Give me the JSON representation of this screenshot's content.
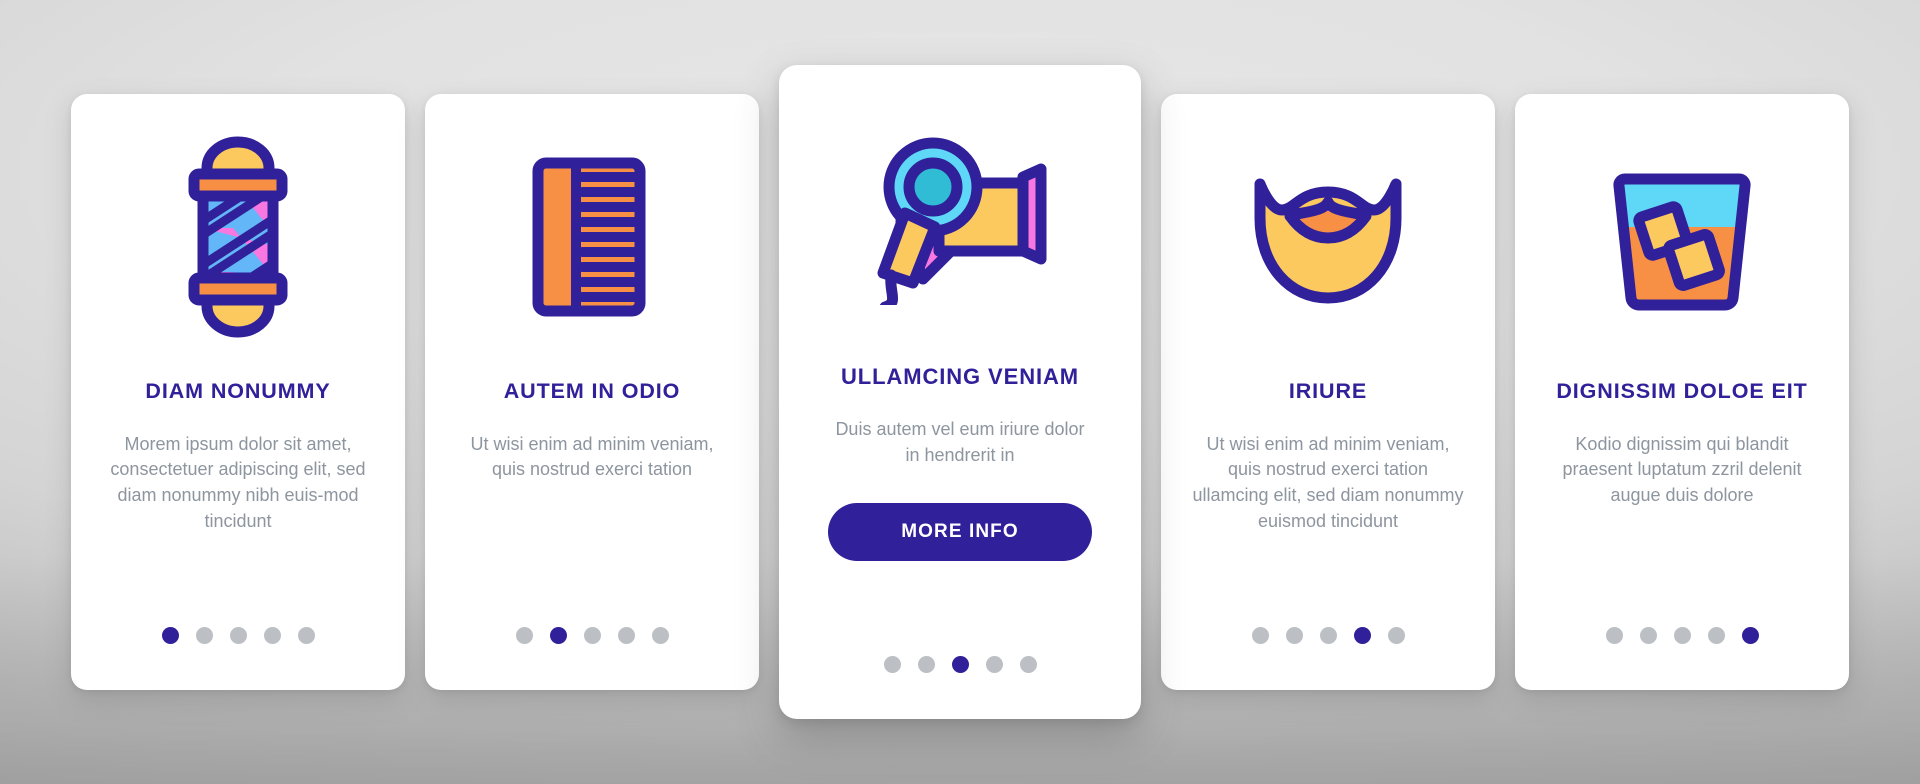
{
  "theme": {
    "purple": "#30209a",
    "body_text": "#8d959f",
    "dot_inactive": "#bcbfc4",
    "card_bg": "#ffffff",
    "background": "#d8d8d8"
  },
  "cards": [
    {
      "icon_name": "barber-pole-icon",
      "title": "DIAM NONUMMY",
      "body": "Morem ipsum dolor sit amet, consectetuer adipiscing elit, sed diam nonummy nibh euis-mod tincidunt",
      "featured": false,
      "dots_count": 5,
      "active_dot": 1
    },
    {
      "icon_name": "hair-comb-icon",
      "title": "AUTEM IN ODIO",
      "body": "Ut wisi enim ad minim veniam, quis nostrud exerci tation",
      "featured": false,
      "dots_count": 5,
      "active_dot": 2
    },
    {
      "icon_name": "hair-dryer-icon",
      "title": "ULLAMCING VENIAM",
      "body": "Duis autem vel eum iriure dolor in hendrerit in",
      "featured": true,
      "button_label": "MORE INFO",
      "dots_count": 5,
      "active_dot": 3
    },
    {
      "icon_name": "beard-icon",
      "title": "IRIURE",
      "body": "Ut wisi enim ad minim veniam, quis nostrud exerci tation ullamcing elit, sed diam nonummy euismod tincidunt",
      "featured": false,
      "dots_count": 5,
      "active_dot": 4
    },
    {
      "icon_name": "whiskey-glass-icon",
      "title": "DIGNISSIM DOLOE EIT",
      "body": "Kodio dignissim qui blandit praesent luptatum zzril delenit augue duis dolore",
      "featured": false,
      "dots_count": 5,
      "active_dot": 5
    }
  ],
  "icon_colors": {
    "outline": "#30209a",
    "yellow": "#fcc95f",
    "orange": "#f79044",
    "pink": "#f977e0",
    "blue": "#63b6f7",
    "light_blue": "#62d3ef",
    "teal": "#2fbcd4",
    "sky": "#5fd7f7"
  }
}
